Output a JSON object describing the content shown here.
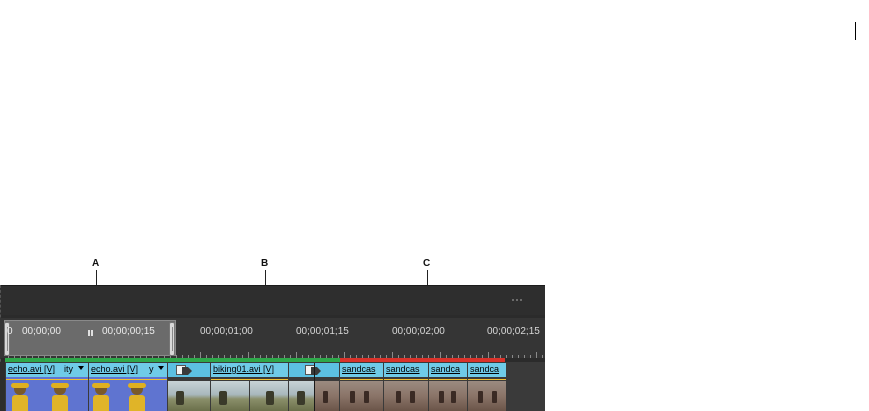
{
  "callouts": [
    {
      "label": "A"
    },
    {
      "label": "B"
    },
    {
      "label": "C"
    }
  ],
  "ruler": {
    "work_area": {
      "start": "00;00;00",
      "end": "00;00;00;15",
      "clipped_char": "0"
    },
    "timecodes": [
      "00;00;01;00",
      "00;00;01;15",
      "00;00;02;00",
      "00;00;02;15"
    ]
  },
  "render_bars": [
    {
      "color": "#2ea84a"
    },
    {
      "color": "#d9332b"
    }
  ],
  "clips": [
    {
      "label": "echo.avi [V]",
      "extra": "ity",
      "type": "echo"
    },
    {
      "label": "echo.avi [V]",
      "extra": "y",
      "type": "echo"
    },
    {
      "label": "biking01.avi [V]",
      "type": "biking"
    },
    {
      "label": "sandcas",
      "type": "sand"
    },
    {
      "label": "sandcas",
      "type": "sand"
    },
    {
      "label": "sandca",
      "type": "sand"
    },
    {
      "label": "sandca",
      "type": "sand"
    }
  ],
  "transitions": [
    {
      "icon": "transition-icon"
    },
    {
      "icon": "transition-icon"
    }
  ],
  "colors": {
    "panel_bg": "#2b2b2b",
    "ruler_bg": "#353535",
    "clip_header": "#6fcbe8",
    "echo_clip_body": "#5f74d0",
    "render_ok": "#2ea84a",
    "render_needed": "#d9332b"
  }
}
